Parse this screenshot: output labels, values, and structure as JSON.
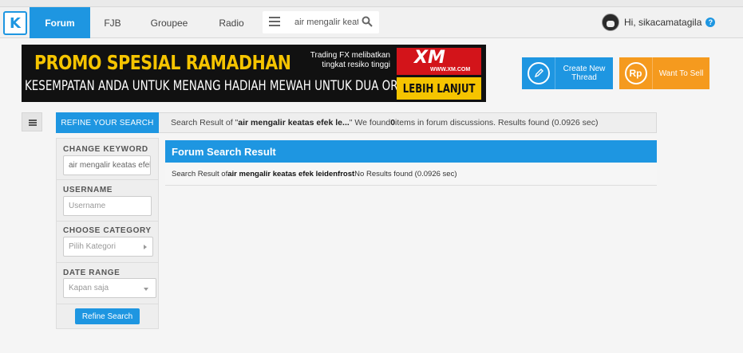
{
  "nav": {
    "logo_glyph": "K",
    "tabs": [
      {
        "label": "Forum",
        "active": true
      },
      {
        "label": "FJB",
        "active": false
      },
      {
        "label": "Groupee",
        "active": false
      },
      {
        "label": "Radio",
        "active": false
      }
    ],
    "search_value": "air mengalir keatas efek leidenfrost",
    "user_greeting": "Hi, sikacamatagila",
    "help_glyph": "?"
  },
  "banner": {
    "title": "PROMO SPESIAL RAMADHAN",
    "subtitle": "KESEMPATAN ANDA UNTUK MENANG HADIAH MEWAH UNTUK DUA ORANG",
    "trading_line1": "Trading FX melibatkan",
    "trading_line2": "tingkat resiko tinggi",
    "brand": "XM",
    "brand_url": "WWW.XM.COM",
    "cta": "LEBIH LANJUT"
  },
  "actions": {
    "create_thread_line1": "Create New",
    "create_thread_line2": "Thread",
    "sell_icon_text": "Rp",
    "sell_label": "Want To Sell"
  },
  "refine": {
    "header": "REFINE YOUR SEARCH",
    "keyword_label": "CHANGE KEYWORD",
    "keyword_value": "air mengalir keatas efek",
    "username_label": "USERNAME",
    "username_placeholder": "Username",
    "category_label": "CHOOSE CATEGORY",
    "category_value": "Pilih Kategori",
    "date_label": "DATE RANGE",
    "date_value": "Kapan saja",
    "button": "Refine Search"
  },
  "info": {
    "prefix": "Search Result of \"",
    "query_short": "air mengalir keatas efek le...",
    "mid": "\" We found ",
    "count": "0",
    "suffix": " items in forum discussions. Results found (0.0926 sec)"
  },
  "result": {
    "title": "Forum Search Result",
    "prefix": "Search Result of ",
    "query": "air mengalir keatas efek leidenfrost",
    "suffix": " No Results found (0.0926 sec)"
  },
  "colors": {
    "accent": "#1e96e1",
    "orange": "#f59a1e",
    "banner_yellow": "#f5c400",
    "xm_red": "#d3141a"
  }
}
